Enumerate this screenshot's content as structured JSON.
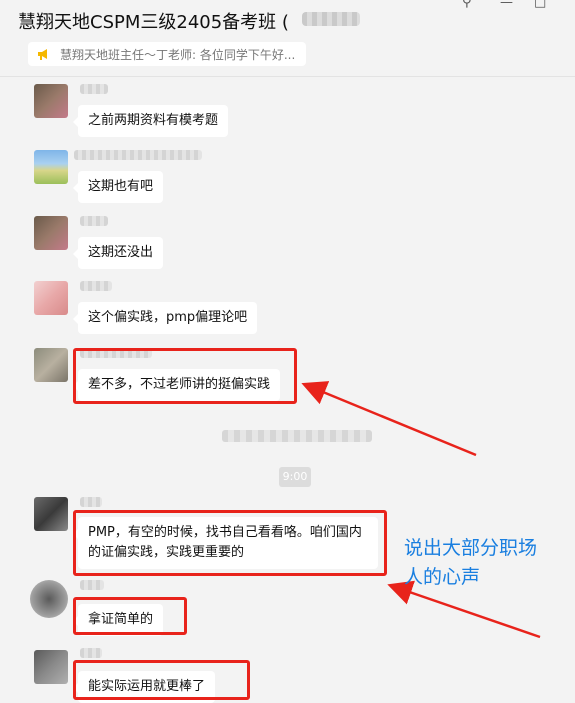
{
  "window": {
    "title": "慧翔天地CSPM三级2405备考班 (",
    "pin_icon": "pin-icon",
    "minimize_icon": "minimize-icon",
    "maximize_icon": "maximize-icon"
  },
  "notice": {
    "icon": "megaphone-icon",
    "text": "慧翔天地班主任～丁老师: 各位同学下午好..."
  },
  "messages": [
    {
      "text": "之前两期资料有模考题"
    },
    {
      "text": "这期也有吧"
    },
    {
      "text": "这期还没出"
    },
    {
      "text": "这个偏实践，pmp偏理论吧"
    },
    {
      "text": "差不多，不过老师讲的挺偏实践"
    },
    {
      "text": "PMP，有空的时候，找书自己看看咯。咱们国内的证偏实践，实践更重要的"
    },
    {
      "text": "拿证简单的"
    },
    {
      "text": "能实际运用就更棒了"
    }
  ],
  "timestamp": "9:00",
  "annotation": {
    "line1": "说出大部分职场",
    "line2": "人的心声"
  },
  "colors": {
    "highlight_box": "#e8231b",
    "annotation_text": "#1a7fe0",
    "background": "#f3f3f3",
    "bubble": "#ffffff"
  }
}
